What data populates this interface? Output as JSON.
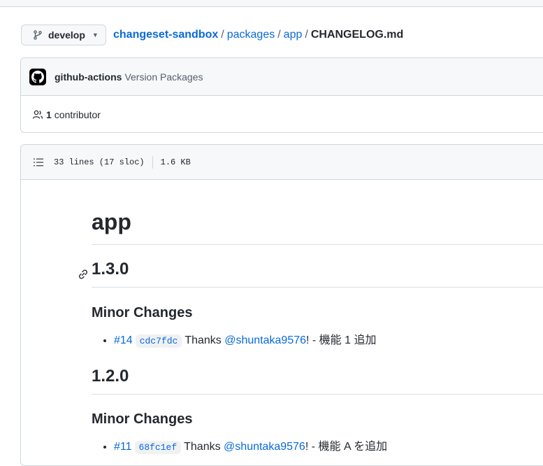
{
  "branch": {
    "label": "develop"
  },
  "breadcrumb": {
    "repo": "changeset-sandbox",
    "sep": "/",
    "path1": "packages",
    "path2": "app",
    "file": "CHANGELOG.md"
  },
  "commit": {
    "author": "github-actions",
    "message": "Version Packages"
  },
  "contributors": {
    "count": "1",
    "label": "contributor"
  },
  "file_info": {
    "lines": "33 lines (17 sloc)",
    "size": "1.6 KB"
  },
  "markdown": {
    "h1": "app",
    "sections": [
      {
        "version": "1.3.0",
        "subheading": "Minor Changes",
        "item": {
          "pr": "#14",
          "sha": "cdc7fdc",
          "thanks": "Thanks",
          "user": "@shuntaka9576",
          "rest": "! - 機能 1 追加"
        }
      },
      {
        "version": "1.2.0",
        "subheading": "Minor Changes",
        "item": {
          "pr": "#11",
          "sha": "68fc1ef",
          "thanks": "Thanks",
          "user": "@shuntaka9576",
          "rest": "! - 機能 A を追加"
        }
      }
    ]
  },
  "colors": {
    "link": "#0969da",
    "border": "#d0d7de",
    "header_bg": "#f6f8fa"
  }
}
